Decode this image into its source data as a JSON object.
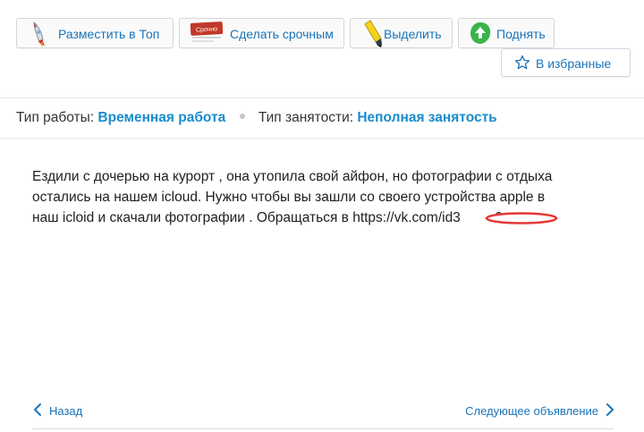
{
  "actions": {
    "top_label": "Разместить в Топ",
    "urgent_label": "Сделать срочным",
    "urgent_badge": "Срочно",
    "highlight_label": "Выделить",
    "raise_label": "Поднять",
    "favorite_label": "В избранные"
  },
  "meta": {
    "work_type_label": "Тип работы:",
    "work_type_value": "Временная работа",
    "employment_label": "Тип занятости:",
    "employment_value": "Неполная занятость"
  },
  "description": {
    "line1": "Ездили с дочерью на курорт , она утопила свой айфон, но фотографии с отдыха",
    "line2": "остались на нашем icloud. Нужно чтобы вы зашли со своего устройства apple в",
    "line3": "наш icloid и скачали фотографии . Обращаться в https://vk.com/id3",
    "line3_tail": "6"
  },
  "nav": {
    "back_label": "Назад",
    "next_label": "Следующее объявление"
  },
  "colors": {
    "link": "#1a73b8",
    "accent": "#1a8ccc",
    "redaction": "#e53935"
  }
}
